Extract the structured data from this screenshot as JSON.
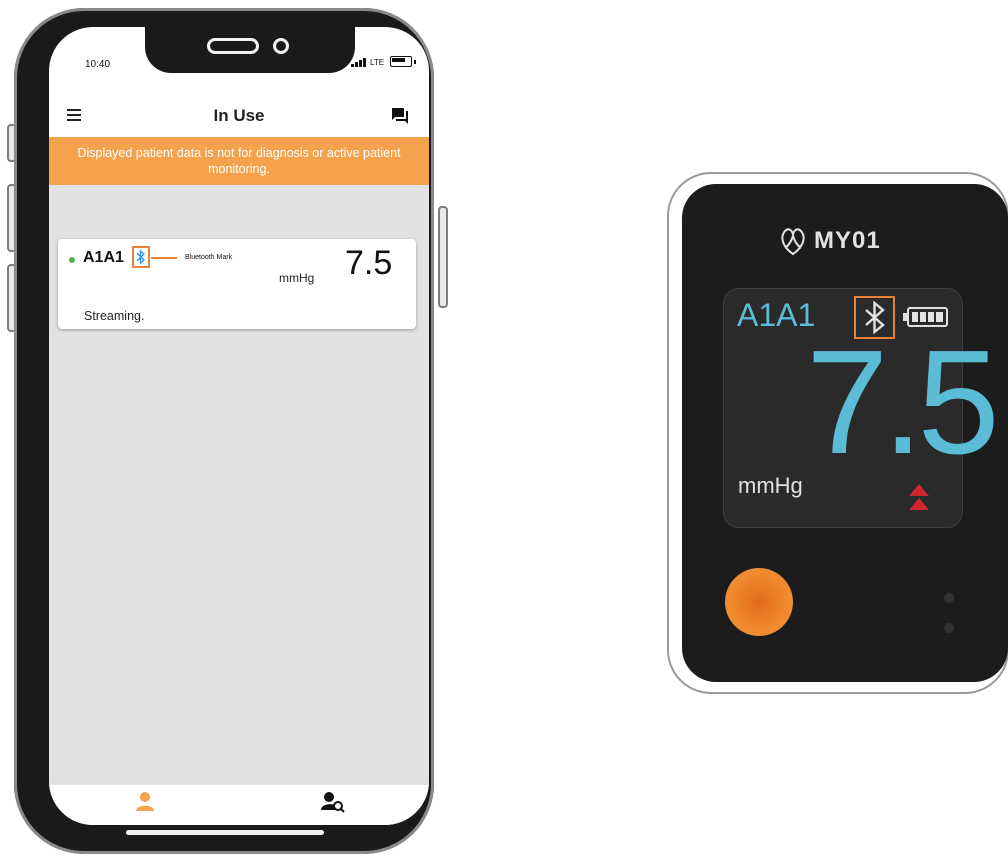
{
  "status_bar": {
    "time": "10:40",
    "network": "LTE"
  },
  "app_bar": {
    "title": "In Use",
    "menu_icon": "menu-icon",
    "chat_icon": "chat-icon"
  },
  "banner": {
    "text": "Displayed patient data is not for diagnosis or active patient monitoring."
  },
  "device_card": {
    "connected": true,
    "name": "A1A1",
    "bluetooth_annotation": "Bluetooth Mark",
    "unit": "mmHg",
    "value": "7.5",
    "status": "Streaming."
  },
  "bottom_nav": [
    {
      "icon": "person-icon",
      "active": true
    },
    {
      "icon": "person-search-icon",
      "active": false
    }
  ],
  "hardware_device": {
    "brand": "MY01",
    "name": "A1A1",
    "value": "7.5",
    "unit": "mmHg",
    "battery_level": 1.0,
    "trend": "rising"
  },
  "colors": {
    "banner": "#f4a24b",
    "accent_orange": "#e8823a",
    "device_readout": "#5bbcd6",
    "bluetooth_blue": "#2a8fe8",
    "status_dot": "#4caf50",
    "trend_arrow": "#d0242e"
  }
}
